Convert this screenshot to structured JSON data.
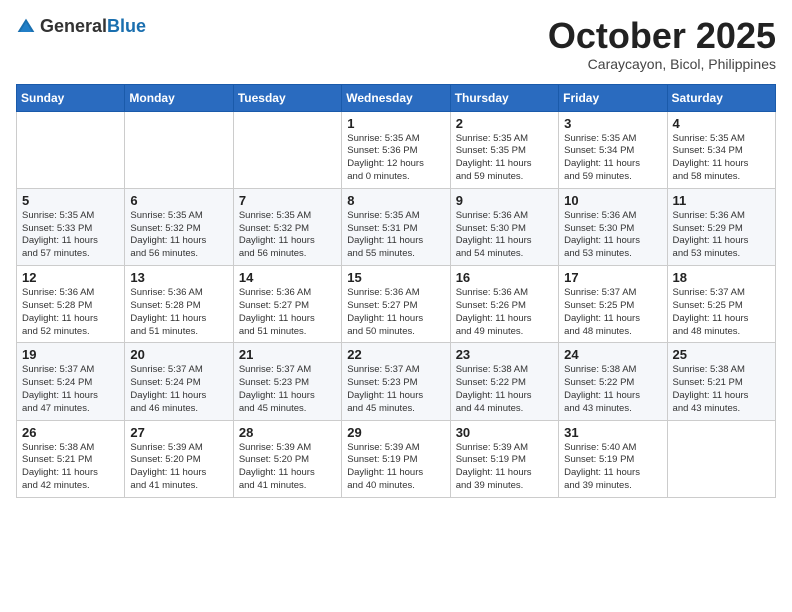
{
  "logo": {
    "general": "General",
    "blue": "Blue"
  },
  "title": "October 2025",
  "subtitle": "Caraycayon, Bicol, Philippines",
  "weekdays": [
    "Sunday",
    "Monday",
    "Tuesday",
    "Wednesday",
    "Thursday",
    "Friday",
    "Saturday"
  ],
  "weeks": [
    [
      {
        "day": "",
        "info": ""
      },
      {
        "day": "",
        "info": ""
      },
      {
        "day": "",
        "info": ""
      },
      {
        "day": "1",
        "info": "Sunrise: 5:35 AM\nSunset: 5:36 PM\nDaylight: 12 hours\nand 0 minutes."
      },
      {
        "day": "2",
        "info": "Sunrise: 5:35 AM\nSunset: 5:35 PM\nDaylight: 11 hours\nand 59 minutes."
      },
      {
        "day": "3",
        "info": "Sunrise: 5:35 AM\nSunset: 5:34 PM\nDaylight: 11 hours\nand 59 minutes."
      },
      {
        "day": "4",
        "info": "Sunrise: 5:35 AM\nSunset: 5:34 PM\nDaylight: 11 hours\nand 58 minutes."
      }
    ],
    [
      {
        "day": "5",
        "info": "Sunrise: 5:35 AM\nSunset: 5:33 PM\nDaylight: 11 hours\nand 57 minutes."
      },
      {
        "day": "6",
        "info": "Sunrise: 5:35 AM\nSunset: 5:32 PM\nDaylight: 11 hours\nand 56 minutes."
      },
      {
        "day": "7",
        "info": "Sunrise: 5:35 AM\nSunset: 5:32 PM\nDaylight: 11 hours\nand 56 minutes."
      },
      {
        "day": "8",
        "info": "Sunrise: 5:35 AM\nSunset: 5:31 PM\nDaylight: 11 hours\nand 55 minutes."
      },
      {
        "day": "9",
        "info": "Sunrise: 5:36 AM\nSunset: 5:30 PM\nDaylight: 11 hours\nand 54 minutes."
      },
      {
        "day": "10",
        "info": "Sunrise: 5:36 AM\nSunset: 5:30 PM\nDaylight: 11 hours\nand 53 minutes."
      },
      {
        "day": "11",
        "info": "Sunrise: 5:36 AM\nSunset: 5:29 PM\nDaylight: 11 hours\nand 53 minutes."
      }
    ],
    [
      {
        "day": "12",
        "info": "Sunrise: 5:36 AM\nSunset: 5:28 PM\nDaylight: 11 hours\nand 52 minutes."
      },
      {
        "day": "13",
        "info": "Sunrise: 5:36 AM\nSunset: 5:28 PM\nDaylight: 11 hours\nand 51 minutes."
      },
      {
        "day": "14",
        "info": "Sunrise: 5:36 AM\nSunset: 5:27 PM\nDaylight: 11 hours\nand 51 minutes."
      },
      {
        "day": "15",
        "info": "Sunrise: 5:36 AM\nSunset: 5:27 PM\nDaylight: 11 hours\nand 50 minutes."
      },
      {
        "day": "16",
        "info": "Sunrise: 5:36 AM\nSunset: 5:26 PM\nDaylight: 11 hours\nand 49 minutes."
      },
      {
        "day": "17",
        "info": "Sunrise: 5:37 AM\nSunset: 5:25 PM\nDaylight: 11 hours\nand 48 minutes."
      },
      {
        "day": "18",
        "info": "Sunrise: 5:37 AM\nSunset: 5:25 PM\nDaylight: 11 hours\nand 48 minutes."
      }
    ],
    [
      {
        "day": "19",
        "info": "Sunrise: 5:37 AM\nSunset: 5:24 PM\nDaylight: 11 hours\nand 47 minutes."
      },
      {
        "day": "20",
        "info": "Sunrise: 5:37 AM\nSunset: 5:24 PM\nDaylight: 11 hours\nand 46 minutes."
      },
      {
        "day": "21",
        "info": "Sunrise: 5:37 AM\nSunset: 5:23 PM\nDaylight: 11 hours\nand 45 minutes."
      },
      {
        "day": "22",
        "info": "Sunrise: 5:37 AM\nSunset: 5:23 PM\nDaylight: 11 hours\nand 45 minutes."
      },
      {
        "day": "23",
        "info": "Sunrise: 5:38 AM\nSunset: 5:22 PM\nDaylight: 11 hours\nand 44 minutes."
      },
      {
        "day": "24",
        "info": "Sunrise: 5:38 AM\nSunset: 5:22 PM\nDaylight: 11 hours\nand 43 minutes."
      },
      {
        "day": "25",
        "info": "Sunrise: 5:38 AM\nSunset: 5:21 PM\nDaylight: 11 hours\nand 43 minutes."
      }
    ],
    [
      {
        "day": "26",
        "info": "Sunrise: 5:38 AM\nSunset: 5:21 PM\nDaylight: 11 hours\nand 42 minutes."
      },
      {
        "day": "27",
        "info": "Sunrise: 5:39 AM\nSunset: 5:20 PM\nDaylight: 11 hours\nand 41 minutes."
      },
      {
        "day": "28",
        "info": "Sunrise: 5:39 AM\nSunset: 5:20 PM\nDaylight: 11 hours\nand 41 minutes."
      },
      {
        "day": "29",
        "info": "Sunrise: 5:39 AM\nSunset: 5:19 PM\nDaylight: 11 hours\nand 40 minutes."
      },
      {
        "day": "30",
        "info": "Sunrise: 5:39 AM\nSunset: 5:19 PM\nDaylight: 11 hours\nand 39 minutes."
      },
      {
        "day": "31",
        "info": "Sunrise: 5:40 AM\nSunset: 5:19 PM\nDaylight: 11 hours\nand 39 minutes."
      },
      {
        "day": "",
        "info": ""
      }
    ]
  ]
}
